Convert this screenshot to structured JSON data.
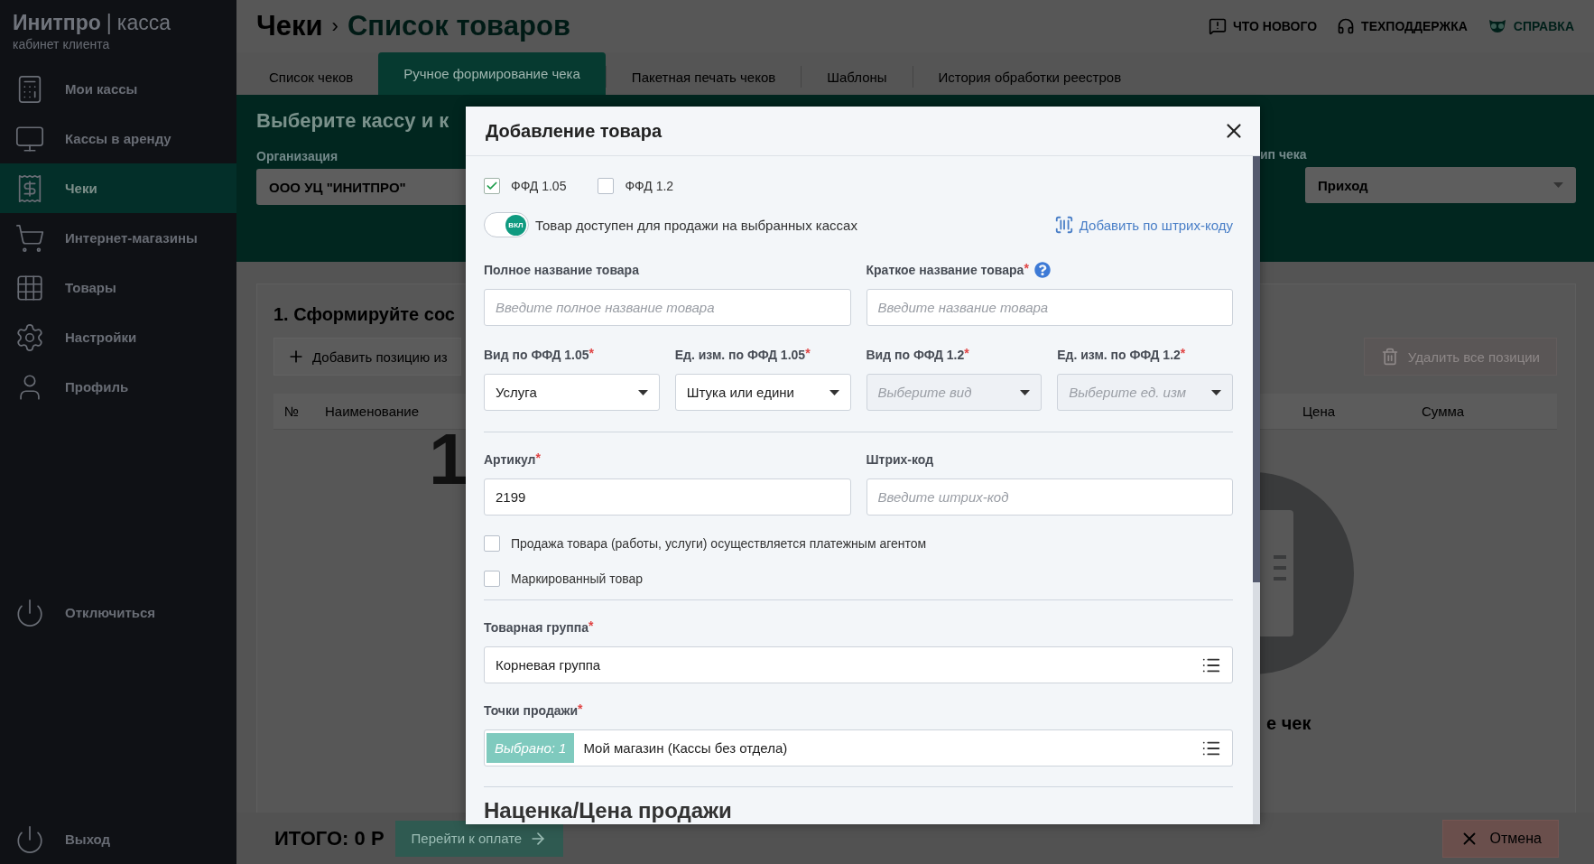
{
  "sidebar": {
    "logo": {
      "brand": "Инитпро",
      "separator": "|",
      "product": "касса",
      "subtitle": "кабинет клиента"
    },
    "items": [
      {
        "label": "Мои кассы",
        "selected": false
      },
      {
        "label": "Кассы в аренду",
        "selected": false
      },
      {
        "label": "Чеки",
        "selected": true
      },
      {
        "label": "Интернет-магазины",
        "selected": false
      },
      {
        "label": "Товары",
        "selected": false
      },
      {
        "label": "Настройки",
        "selected": false
      },
      {
        "label": "Профиль",
        "selected": false
      }
    ],
    "disconnect": "Отключиться",
    "logout": "Выход"
  },
  "header": {
    "breadcrumb": "Чеки",
    "separator": "›",
    "title": "Список товаров",
    "links": [
      {
        "label": "ЧТО НОВОГО",
        "kind": "news"
      },
      {
        "label": "ТЕХПОДДЕРЖКА",
        "kind": "support"
      },
      {
        "label": "СПРАВКА",
        "kind": "help"
      }
    ]
  },
  "tabs": [
    {
      "label": "Список чеков",
      "selected": false
    },
    {
      "label": "Ручное формирование чека",
      "selected": true
    },
    {
      "label": "Пакетная печать чеков",
      "selected": false
    },
    {
      "label": "Шаблоны",
      "selected": false
    },
    {
      "label": "История обработки реестров",
      "selected": false
    }
  ],
  "selection_panel": {
    "title": "Выберите кассу и к",
    "organization": {
      "label": "Организация",
      "value": "ООО УЦ \"ИНИТПРО\""
    },
    "receipt_type": {
      "label": "ип чека",
      "value": "Приход"
    }
  },
  "compose_card": {
    "title": "1. Сформируйте сос",
    "add_button": "Добавить позицию из",
    "delete_all_button": {
      "label": "Удалить все позиции",
      "disabled": true
    },
    "columns_left": [
      "№",
      "Наименование"
    ],
    "columns_right": [
      "Цена",
      "Сумма"
    ],
    "empty_step": "1",
    "empty_caption": "е чек"
  },
  "footer": {
    "total": "ИТОГО: 0 Р",
    "pay_button": {
      "label": "Перейти к оплате",
      "disabled": true
    },
    "cancel_button": "Отмена"
  },
  "modal": {
    "title": "Добавление товара",
    "ffd_options": [
      {
        "label": "ФФД 1.05",
        "checked": true
      },
      {
        "label": "ФФД 1.2",
        "checked": false
      }
    ],
    "availability_toggle": {
      "on": true,
      "knob_label": "ВКЛ",
      "label": "Товар доступен для продажи на выбранных кассах"
    },
    "barcode_link": "Добавить по штрих-коду",
    "name_fields": [
      {
        "label": "Полное название товара",
        "placeholder": "Введите полное название товара"
      },
      {
        "label": "Краткое название товара",
        "mark": "*",
        "help": true,
        "placeholder": "Введите название товара"
      }
    ],
    "type_selects": [
      {
        "label": "Вид по ФФД 1.05",
        "mark": "*",
        "value": "Услуга",
        "disabled": false
      },
      {
        "label": "Ед. изм. по ФФД 1.05",
        "mark": "*",
        "value": "Штука или едини",
        "disabled": false
      },
      {
        "label": "Вид по ФФД 1.2",
        "mark": "*",
        "placeholder": "Выберите вид",
        "disabled": true
      },
      {
        "label": "Ед. изм. по ФФД 1.2",
        "mark": "*",
        "placeholder": "Выберите ед. изм",
        "disabled": true
      }
    ],
    "code_fields": [
      {
        "label": "Артикул",
        "mark": "*",
        "value": "2199"
      },
      {
        "label": "Штрих-код",
        "placeholder": "Введите штрих-код"
      }
    ],
    "flags": [
      {
        "label": "Продажа товара (работы, услуги) осуществляется платежным агентом",
        "checked": false
      },
      {
        "label": "Маркированный товар",
        "checked": false
      }
    ],
    "product_group": {
      "label": "Товарная группа",
      "mark": "*",
      "value": "Корневая группа"
    },
    "sale_points": {
      "label": "Точки продажи",
      "mark": "*",
      "badge": "Выбрано: 1",
      "value": "Мой магазин (Кассы без отдела)"
    },
    "section_heading": "Наценка/Цена продажи"
  }
}
